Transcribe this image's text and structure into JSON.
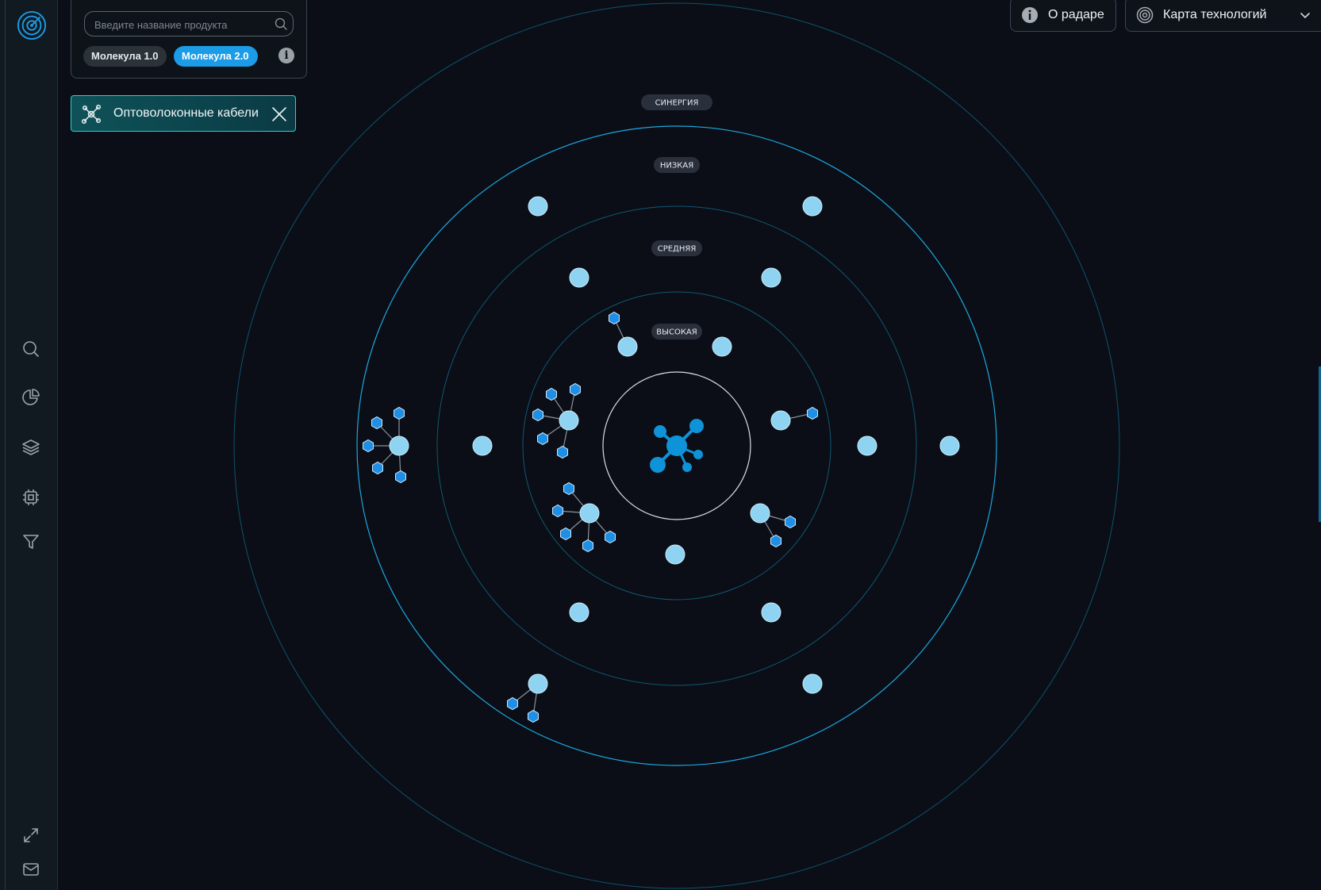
{
  "search": {
    "placeholder": "Введите название продукта",
    "value": ""
  },
  "molecule_versions": [
    {
      "label": "Молекула 1.0",
      "active": false
    },
    {
      "label": "Молекула 2.0",
      "active": true
    }
  ],
  "info_glyph": "i",
  "selected_product": {
    "label": "Оптоволоконные кабели",
    "icon": "molecule-icon"
  },
  "header": {
    "about_label": "О радаре",
    "map_label": "Карта технологий"
  },
  "sidebar_icons": [
    "logo-target-icon",
    "search-icon",
    "pie-chart-icon",
    "layers-icon",
    "chip-icon",
    "filter-icon",
    "expand-icon",
    "mail-icon"
  ],
  "colors": {
    "accent": "#1c9ce6",
    "ring": "#0e6b8c",
    "ring_bright": "#1ba7de",
    "node": "#8fd3f3",
    "hex_node": "#1f8fe6",
    "center_molecule": "#0f93d8",
    "tag_border": "#2dd0c6"
  },
  "radar": {
    "rings": [
      {
        "label": "ВЫСОКАЯ",
        "level": 1
      },
      {
        "label": "СРЕДНЯЯ",
        "level": 2
      },
      {
        "label": "НИЗКАЯ",
        "level": 3
      },
      {
        "label": "СИНЕРГИЯ",
        "level": 4
      }
    ],
    "node_count": 24
  }
}
